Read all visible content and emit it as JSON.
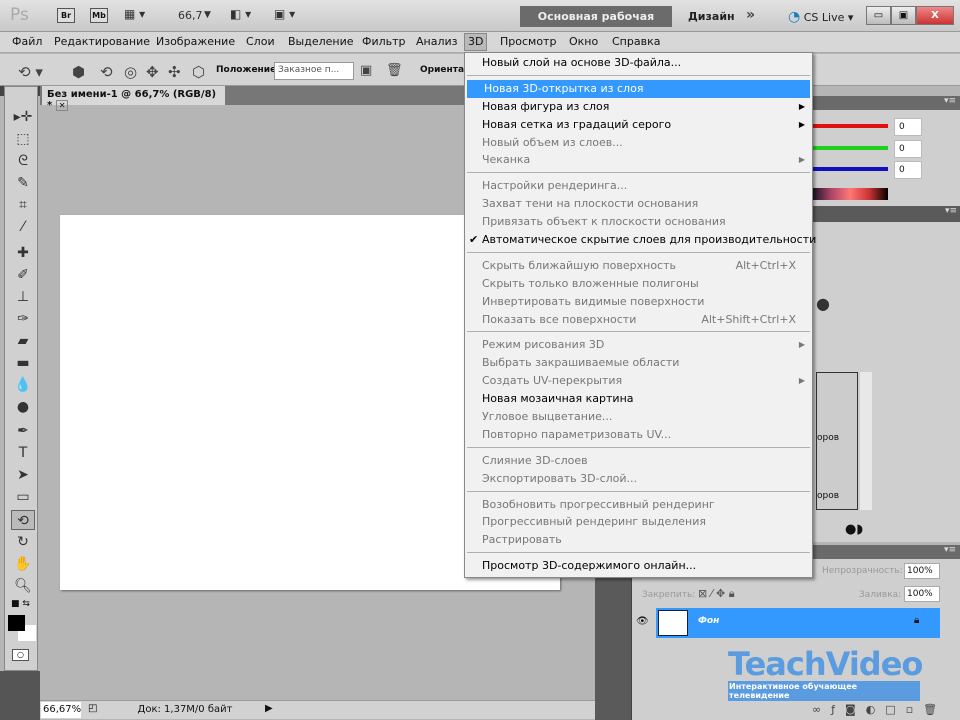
{
  "titlebar": {
    "logo": "Ps",
    "bridge": "Br",
    "minibridge": "Mb",
    "zoom": "66,7",
    "workspace": "Основная рабочая среда",
    "design": "Дизайн",
    "more": "»",
    "cslive": "CS Live ▾",
    "minimize": "▭",
    "restore": "▣",
    "close": "X"
  },
  "menubar": [
    "Файл",
    "Редактирование",
    "Изображение",
    "Слои",
    "Выделение",
    "Фильтр",
    "Анализ",
    "3D",
    "Просмотр",
    "Окно",
    "Справка"
  ],
  "options": {
    "position_label": "Положение:",
    "position_value": "Заказное п...",
    "orientation_label": "Ориента"
  },
  "document": {
    "tab": "Без имени-1 @ 66,7% (RGB/8) *",
    "zoom": "66,67%",
    "info": "Док: 1,37M/0 байт"
  },
  "color_panel": {
    "r": "0",
    "g": "0",
    "b": "0",
    "colors": {
      "r": "#e01010",
      "g": "#20d020",
      "b": "#1010c0"
    }
  },
  "styles_panel": {
    "row_labels": [
      "оров",
      "оров"
    ]
  },
  "layers_panel": {
    "opacity_label": "Непрозрачность:",
    "opacity": "100%",
    "lock_label": "Закрепить:",
    "fill_label": "Заливка:",
    "fill": "100%",
    "layer_name": "Фон"
  },
  "watermark": {
    "brand": "TeachVideo",
    "tagline": "Интерактивное обучающее телевидение"
  },
  "menu_3d": [
    {
      "label": "Новый слой на основе 3D-файла..."
    },
    {
      "sep": true
    },
    {
      "label": "Новая 3D-открытка из слоя",
      "highlight": true
    },
    {
      "label": "Новая фигура из слоя",
      "submenu": true
    },
    {
      "label": "Новая сетка из градаций серого",
      "submenu": true
    },
    {
      "label": "Новый объем из слоев...",
      "disabled": true
    },
    {
      "label": "Чеканка",
      "disabled": true,
      "submenu": true
    },
    {
      "sep": true
    },
    {
      "label": "Настройки рендеринга...",
      "disabled": true
    },
    {
      "label": "Захват тени на плоскости основания",
      "disabled": true
    },
    {
      "label": "Привязать объект к плоскости основания",
      "disabled": true
    },
    {
      "label": "Автоматическое скрытие слоев для производительности",
      "checked": true
    },
    {
      "sep": true
    },
    {
      "label": "Скрыть ближайшую поверхность",
      "disabled": true,
      "shortcut": "Alt+Ctrl+X"
    },
    {
      "label": "Скрыть только вложенные полигоны",
      "disabled": true
    },
    {
      "label": "Инвертировать видимые поверхности",
      "disabled": true
    },
    {
      "label": "Показать все поверхности",
      "disabled": true,
      "shortcut": "Alt+Shift+Ctrl+X"
    },
    {
      "sep": true
    },
    {
      "label": "Режим рисования 3D",
      "disabled": true,
      "submenu": true
    },
    {
      "label": "Выбрать закрашиваемые области",
      "disabled": true
    },
    {
      "label": "Создать UV-перекрытия",
      "disabled": true,
      "submenu": true
    },
    {
      "label": "Новая мозаичная картина"
    },
    {
      "label": "Угловое выцветание...",
      "disabled": true
    },
    {
      "label": "Повторно параметризовать UV...",
      "disabled": true
    },
    {
      "sep": true
    },
    {
      "label": "Слияние 3D-слоев",
      "disabled": true
    },
    {
      "label": "Экспортировать 3D-слой...",
      "disabled": true
    },
    {
      "sep": true
    },
    {
      "label": "Возобновить прогрессивный рендеринг",
      "disabled": true
    },
    {
      "label": "Прогрессивный рендеринг выделения",
      "disabled": true
    },
    {
      "label": "Растрировать",
      "disabled": true
    },
    {
      "sep": true
    },
    {
      "label": "Просмотр 3D-содержимого онлайн..."
    }
  ]
}
